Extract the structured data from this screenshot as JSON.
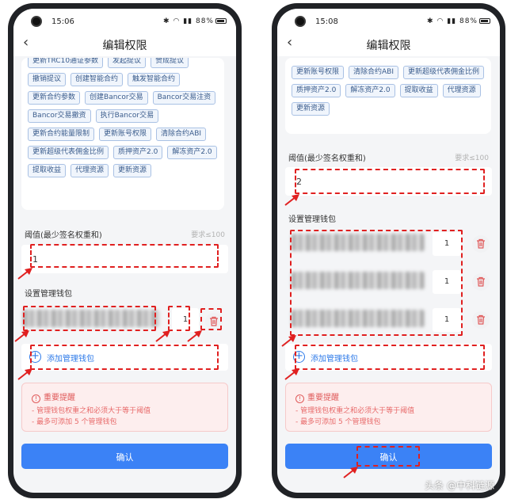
{
  "left": {
    "status": {
      "time": "15:06",
      "battery": "88%"
    },
    "nav": {
      "title": "编辑权限"
    },
    "permissions": [
      "更新TRC10通证参数",
      "发起提议",
      "赞成提议",
      "撤销提议",
      "创建智能合约",
      "触发智能合约",
      "更新合约参数",
      "创建Bancor交易",
      "Bancor交易注资",
      "Bancor交易撤资",
      "执行Bancor交易",
      "更新合约能量限制",
      "更新账号权限",
      "清除合约ABI",
      "更新超级代表佣金比例",
      "质押资产2.0",
      "解冻资产2.0",
      "提取收益",
      "代理资源",
      "更新资源"
    ],
    "threshold": {
      "label": "阈值(最少签名权重和)",
      "hint": "要求≤100",
      "value": "1"
    },
    "wallets": {
      "label": "设置管理钱包",
      "items": [
        {
          "weight": "1"
        }
      ]
    },
    "add_wallet": "添加管理钱包",
    "notice": {
      "title": "重要提醒",
      "lines": [
        "- 管理钱包权重之和必须大于等于阈值",
        "- 最多可添加 5 个管理钱包"
      ]
    },
    "confirm": "确认"
  },
  "right": {
    "status": {
      "time": "15:08",
      "battery": "88%"
    },
    "nav": {
      "title": "编辑权限"
    },
    "permissions": [
      "更新账号权限",
      "清除合约ABI",
      "更新超级代表佣金比例",
      "质押资产2.0",
      "解冻资产2.0",
      "提取收益",
      "代理资源",
      "更新资源"
    ],
    "threshold": {
      "label": "阈值(最少签名权重和)",
      "hint": "要求≤100",
      "value": "2"
    },
    "wallets": {
      "label": "设置管理钱包",
      "items": [
        {
          "weight": "1"
        },
        {
          "weight": "1"
        },
        {
          "weight": "1"
        }
      ]
    },
    "add_wallet": "添加管理钱包",
    "notice": {
      "title": "重要提醒",
      "lines": [
        "- 管理钱包权重之和必须大于等于阈值",
        "- 最多可添加 5 个管理钱包"
      ]
    },
    "confirm": "确认"
  },
  "watermark": "头条 @中科链源",
  "colors": {
    "accent": "#3b82f6",
    "highlight": "#e02020",
    "tag_border": "#a9c1e4",
    "notice_bg": "#fdeeee"
  }
}
